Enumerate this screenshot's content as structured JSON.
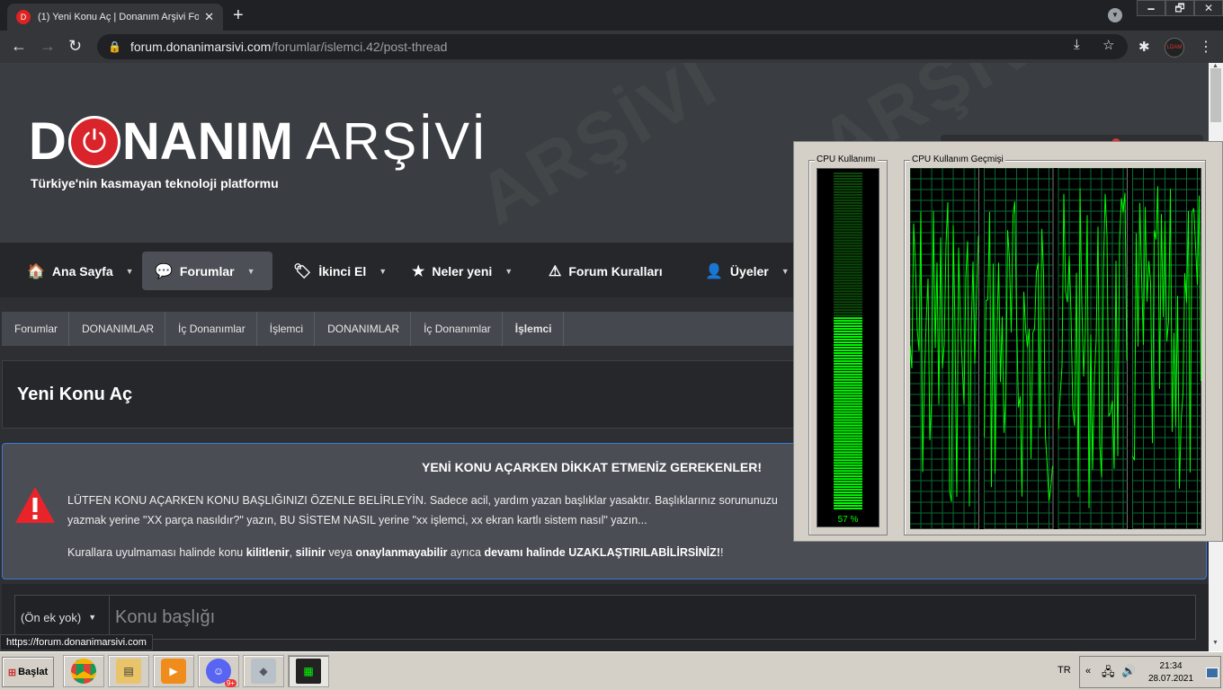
{
  "browser": {
    "tab_title": "(1) Yeni Konu Aç | Donanım Arşivi Fo",
    "tab_favicon_letter": "D",
    "tab_close": "✕",
    "new_tab": "+",
    "url_host": "forum.donanimarsivi.com",
    "url_path": "/forumlar/islemci.42/post-thread",
    "window_controls": [
      "🗕",
      "🗗",
      "✕"
    ],
    "profile_label": "LDAM"
  },
  "site": {
    "logo_d": "D",
    "logo_rest": "NANIM",
    "logo_arsivi": "ARŞİVİ",
    "tagline": "Türkiye'nin kasmayan teknoloji platformu",
    "watermark": "ARŞİVİ"
  },
  "nav": {
    "items": [
      {
        "label": "Ana Sayfa",
        "icon": "🏠",
        "caret": "▼"
      },
      {
        "label": "Forumlar",
        "icon": "💬",
        "caret": "▼"
      },
      {
        "label": "İkinci El",
        "icon": "🏷",
        "caret": "▼"
      },
      {
        "label": "Neler yeni",
        "icon": "★",
        "caret": "▼"
      },
      {
        "label": "Forum Kuralları",
        "icon": "⚠",
        "caret": ""
      },
      {
        "label": "Üyeler",
        "icon": "👤",
        "caret": "▼"
      }
    ]
  },
  "breadcrumbs": [
    "Forumlar",
    "DONANIMLAR",
    "İç Donanımlar",
    "İşlemci",
    "DONANIMLAR",
    "İç Donanımlar",
    "İşlemci"
  ],
  "page_title": "Yeni Konu Aç",
  "notice": {
    "heading": "YENİ KONU AÇARKEN DİKKAT ETMENİZ GEREKENLER!",
    "line1": "LÜTFEN KONU AÇARKEN KONU BAŞLIĞINIZI ÖZENLE BELİRLEYİN. Sadece acil, yardım yazan başlıklar yasaktır. Başlıklarınız sorununuzu",
    "line2": "yazmak yerine \"XX parça nasıldır?\" yazın, BU SİSTEM NASIL yerine \"xx işlemci, xx ekran kartlı sistem nasıl\" yazın...",
    "line3_a": "Kurallara uyulmaması halinde konu ",
    "line3_b": "kilitlenir",
    "line3_c": ", ",
    "line3_d": "silinir",
    "line3_e": " veya ",
    "line3_f": "onaylanmayabilir",
    "line3_g": " ayrıca ",
    "line3_h": "devamı halinde UZAKLAŞTIRILABİLİRSİNİZ!",
    "line3_i": "!"
  },
  "form": {
    "prefix_value": "(Ön ek yok)",
    "title_placeholder": "Konu başlığı"
  },
  "status_bar_url": "https://forum.donanimarsivi.com",
  "cpu_widget": {
    "usage_label": "CPU Kullanımı",
    "history_label": "CPU Kullanım Geçmişi",
    "usage_percent": 57,
    "usage_text": "57 %",
    "core_count": 4,
    "accent": "#00ff00"
  },
  "taskbar": {
    "start_label": "Başlat",
    "lang": "TR",
    "time": "21:34",
    "date": "28.07.2021",
    "apps": [
      "chrome",
      "file-explorer",
      "media-player",
      "discord",
      "app-generic",
      "task-manager"
    ],
    "discord_badge": "9+"
  }
}
